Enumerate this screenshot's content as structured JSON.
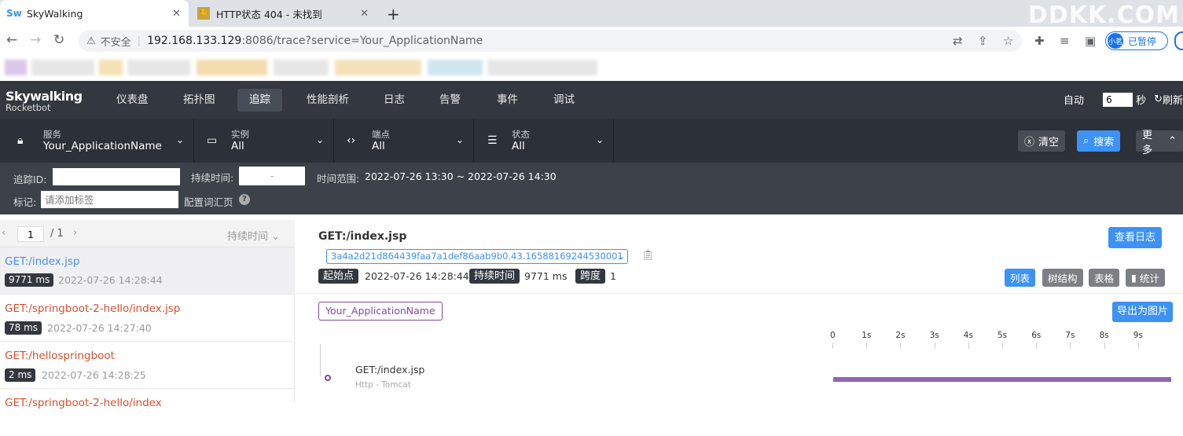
{
  "browser": {
    "tabs": [
      {
        "title": "SkyWalking",
        "active": true
      },
      {
        "title": "HTTP状态 404 - 未找到",
        "active": false
      }
    ],
    "watermark": "DDKK.COM",
    "address": {
      "insecure_label": "不安全",
      "host": "192.168.133.129",
      "rest": ":8086/trace?service=Your_ApplicationName"
    },
    "profile": {
      "avatar": "小茗",
      "label": "已暂停"
    }
  },
  "app": {
    "logo": {
      "line1": "Skywalking",
      "line2": "Rocketbot"
    },
    "nav": [
      {
        "label": "仪表盘",
        "active": false
      },
      {
        "label": "拓扑图",
        "active": false
      },
      {
        "label": "追踪",
        "active": true
      },
      {
        "label": "性能剖析",
        "active": false
      },
      {
        "label": "日志",
        "active": false
      },
      {
        "label": "告警",
        "active": false
      },
      {
        "label": "事件",
        "active": false
      },
      {
        "label": "调试",
        "active": false
      }
    ],
    "auto_label": "自动",
    "auto_value": "6",
    "auto_unit": "秒",
    "refresh_label": "刷新"
  },
  "filters": {
    "service": {
      "label": "服务",
      "value": "Your_ApplicationName"
    },
    "instance": {
      "label": "实例",
      "value": "All"
    },
    "endpoint": {
      "label": "端点",
      "value": "All"
    },
    "status": {
      "label": "状态",
      "value": "All"
    },
    "clear_label": "清空",
    "search_label": "搜索",
    "more_label": "更多"
  },
  "search": {
    "trace_id_label": "追踪ID:",
    "trace_id_value": "",
    "duration_label": "持续时间:",
    "duration_sep": "-",
    "time_range_label": "时间范围:",
    "time_range_value": "2022-07-26 13:30 ~ 2022-07-26 14:30",
    "tags_label": "标记:",
    "tags_placeholder": "请添加标签",
    "tags_config_label": "配置词汇页"
  },
  "list": {
    "page": "1",
    "total": "/ 1",
    "sort_label": "持续时间",
    "traces": [
      {
        "name": "GET:/index.jsp",
        "duration": "9771 ms",
        "time": "2022-07-26 14:28:44",
        "error": false,
        "selected": true
      },
      {
        "name": "GET:/springboot-2-hello/index.jsp",
        "duration": "78 ms",
        "time": "2022-07-26 14:27:40",
        "error": true,
        "selected": false
      },
      {
        "name": "GET:/hellospringboot",
        "duration": "2 ms",
        "time": "2022-07-26 14:28:25",
        "error": true,
        "selected": false
      },
      {
        "name": "GET:/springboot-2-hello/index",
        "duration": "",
        "time": "",
        "error": true,
        "selected": false
      }
    ]
  },
  "detail": {
    "title": "GET:/index.jsp",
    "view_logs_label": "查看日志",
    "trace_id": "3a4a2d21d864439faa7a1def86aab9b0.43.16588169244530001",
    "start_label": "起始点",
    "start_value": "2022-07-26 14:28:44",
    "duration_label": "持续时间",
    "duration_value": "9771 ms",
    "span_label": "跨度",
    "span_value": "1",
    "views": [
      "列表",
      "树结构",
      "表格",
      "统计"
    ],
    "service_tag": "Your_ApplicationName",
    "export_label": "导出为图片",
    "timeline_ticks": [
      "0",
      "1s",
      "2s",
      "3s",
      "4s",
      "5s",
      "6s",
      "7s",
      "8s",
      "9s"
    ],
    "span_name": "GET:/index.jsp",
    "span_sub": "Http - Tomcat"
  },
  "colors": {
    "nav_bg": "#333840",
    "filter_bg": "#2c3038",
    "search_bg": "#3d424a",
    "primary": "#3d92f3",
    "secondary_btn": "#7c7f83",
    "error_text": "#d4502f",
    "link_text": "#4a8ff0",
    "service_purple": "#7b4aa6"
  }
}
